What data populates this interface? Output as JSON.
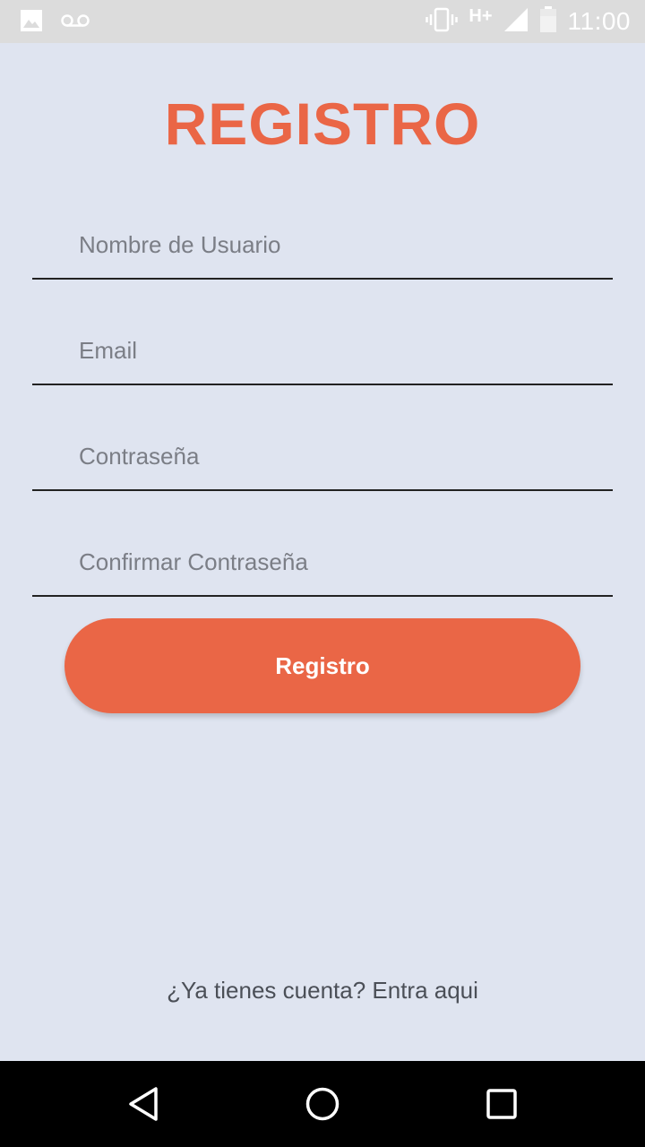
{
  "status_bar": {
    "network_type": "H+",
    "time": "11:00",
    "icons": [
      "image-icon",
      "voicemail-icon",
      "vibrate-icon",
      "signal-icon",
      "battery-icon"
    ]
  },
  "form": {
    "title": "REGISTRO",
    "username_placeholder": "Nombre de Usuario",
    "email_placeholder": "Email",
    "password_placeholder": "Contraseña",
    "confirm_password_placeholder": "Confirmar Contraseña",
    "submit_label": "Registro",
    "login_link": "¿Ya tienes cuenta? Entra aqui"
  },
  "nav_bar": {
    "icons": [
      "back-icon",
      "home-icon",
      "recents-icon"
    ]
  },
  "colors": {
    "accent": "#ea6646",
    "background": "#dfe4f0",
    "status_bar": "#dcdcdc",
    "nav_bar": "#000000"
  }
}
